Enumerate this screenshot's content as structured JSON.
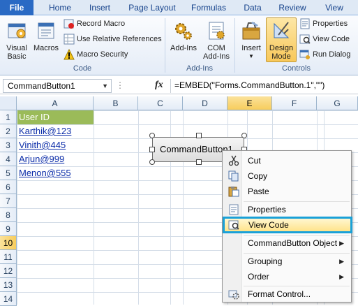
{
  "tabs": [
    "File",
    "Home",
    "Insert",
    "Page Layout",
    "Formulas",
    "Data",
    "Review",
    "View"
  ],
  "ribbon": {
    "code": {
      "visual_basic": [
        "Visual",
        "Basic"
      ],
      "macros": "Macros",
      "record_macro": "Record Macro",
      "relative_refs": "Use Relative References",
      "macro_security": "Macro Security",
      "label": "Code"
    },
    "addins": {
      "addins": "Add-Ins",
      "com_addins": [
        "COM",
        "Add-Ins"
      ],
      "label": "Add-Ins"
    },
    "controls": {
      "insert": "Insert",
      "design_mode": [
        "Design",
        "Mode"
      ],
      "properties": "Properties",
      "view_code": "View Code",
      "run_dialog": "Run Dialog",
      "label": "Controls"
    }
  },
  "formula_bar": {
    "name_box": "CommandButton1",
    "fx": "fx",
    "formula": "=EMBED(\"Forms.CommandButton.1\",\"\")"
  },
  "columns": [
    "A",
    "B",
    "C",
    "D",
    "E",
    "F",
    "G"
  ],
  "rows": [
    "1",
    "2",
    "3",
    "4",
    "5",
    "6",
    "7",
    "8",
    "9",
    "10",
    "11",
    "12",
    "13",
    "14"
  ],
  "cells": {
    "A1": "User ID",
    "A2": "Karthik@123",
    "A3": "Vinith@445",
    "A4": "Arjun@999",
    "A5": "Menon@555"
  },
  "command_button": "CommandButton1",
  "context_menu": {
    "cut": "Cut",
    "copy": "Copy",
    "paste": "Paste",
    "properties": "Properties",
    "view_code": "View Code",
    "cmd_object": "CommandButton Object",
    "grouping": "Grouping",
    "order": "Order",
    "format_control": "Format Control..."
  },
  "colors": {
    "file_tab": "#2a6ac4",
    "header_cell": "#9bbb59",
    "link": "#0b2ca8",
    "highlight_border": "#1aa1d8"
  }
}
